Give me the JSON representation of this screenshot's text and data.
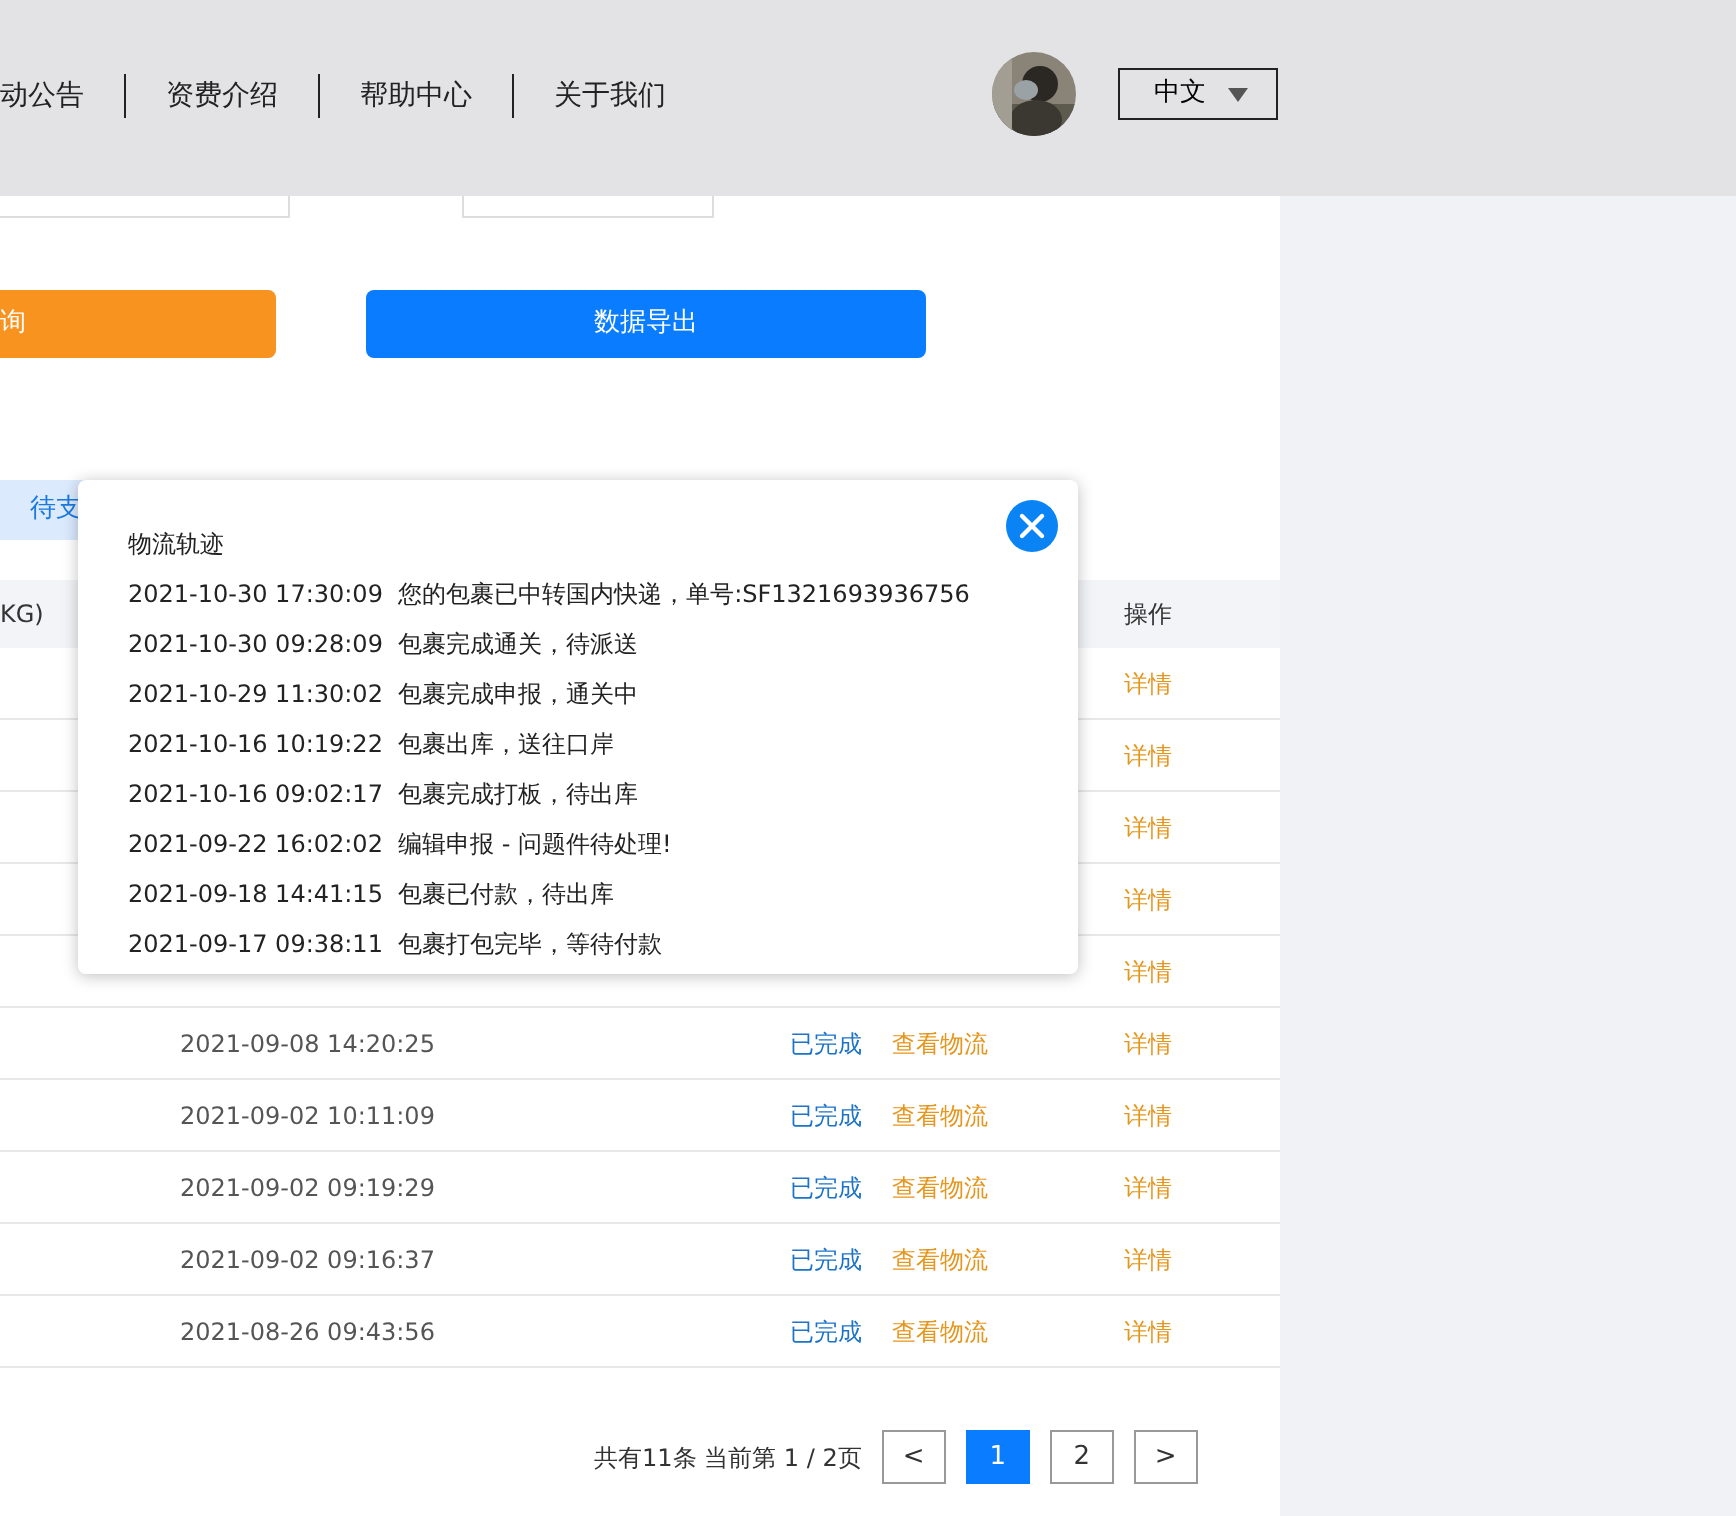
{
  "header": {
    "nav": [
      "动公告",
      "资费介绍",
      "帮助中心",
      "关于我们"
    ],
    "language": "中文"
  },
  "search": {
    "query_button": "询",
    "export_button": "数据导出"
  },
  "tabs": [
    {
      "label": "待支",
      "selected": true
    }
  ],
  "table": {
    "columns": [
      "KG)",
      "操作"
    ],
    "rows": [
      {
        "action": "详情"
      },
      {
        "action": "详情"
      },
      {
        "action": "详情"
      },
      {
        "action": "详情"
      },
      {
        "action": "详情"
      },
      {
        "time": "2021-09-08 14:20:25",
        "status": "已完成",
        "logistics": "查看物流",
        "action": "详情"
      },
      {
        "time": "2021-09-02 10:11:09",
        "status": "已完成",
        "logistics": "查看物流",
        "action": "详情"
      },
      {
        "time": "2021-09-02 09:19:29",
        "status": "已完成",
        "logistics": "查看物流",
        "action": "详情"
      },
      {
        "time": "2021-09-02 09:16:37",
        "status": "已完成",
        "logistics": "查看物流",
        "action": "详情"
      },
      {
        "time": "2021-08-26 09:43:56",
        "status": "已完成",
        "logistics": "查看物流",
        "action": "详情"
      }
    ]
  },
  "pagination": {
    "summary": "共有11条 当前第 1 / 2页",
    "prev": "<",
    "pages": [
      {
        "label": "1",
        "selected": true
      },
      {
        "label": "2",
        "selected": false
      }
    ],
    "next": ">"
  },
  "modal": {
    "title": "物流轨迹",
    "events": [
      {
        "time": "2021-10-30 17:30:09",
        "text": "您的包裹已中转国内快递，单号:SF1321693936756"
      },
      {
        "time": "2021-10-30 09:28:09",
        "text": "包裹完成通关，待派送"
      },
      {
        "time": "2021-10-29 11:30:02",
        "text": "包裹完成申报，通关中"
      },
      {
        "time": "2021-10-16 10:19:22",
        "text": "包裹出库，送往口岸"
      },
      {
        "time": "2021-10-16 09:02:17",
        "text": "包裹完成打板，待出库"
      },
      {
        "time": "2021-09-22 16:02:02",
        "text": "编辑申报 - 问题件待处理!"
      },
      {
        "time": "2021-09-18 14:41:15",
        "text": "包裹已付款，待出库"
      },
      {
        "time": "2021-09-17 09:38:11",
        "text": "包裹打包完毕，等待付款"
      }
    ]
  }
}
